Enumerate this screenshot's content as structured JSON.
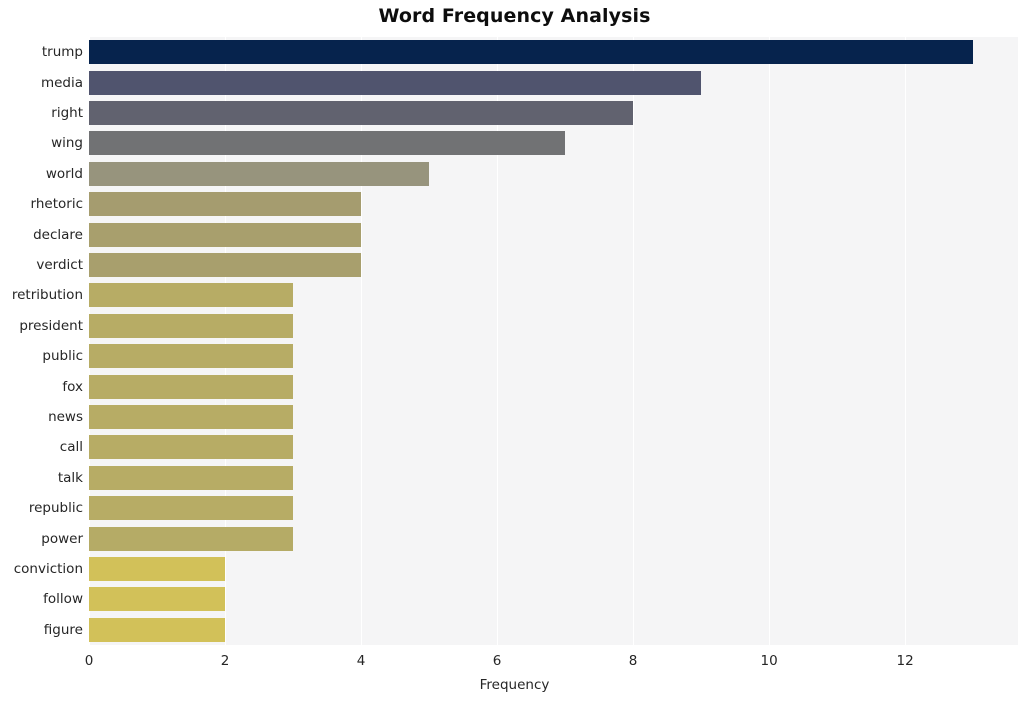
{
  "chart_data": {
    "type": "bar",
    "orientation": "horizontal",
    "title": "Word Frequency Analysis",
    "xlabel": "Frequency",
    "ylabel": "",
    "categories": [
      "trump",
      "media",
      "right",
      "wing",
      "world",
      "rhetoric",
      "declare",
      "verdict",
      "retribution",
      "president",
      "public",
      "fox",
      "news",
      "call",
      "talk",
      "republic",
      "power",
      "conviction",
      "follow",
      "figure"
    ],
    "values": [
      13,
      9,
      8,
      7,
      5,
      4,
      4,
      4,
      3,
      3,
      3,
      3,
      3,
      3,
      3,
      3,
      3,
      2,
      2,
      2
    ],
    "bar_colors": [
      "#06234d",
      "#50546e",
      "#61626f",
      "#717274",
      "#97947d",
      "#a59c6f",
      "#a89f6d",
      "#a89f6d",
      "#b7ac65",
      "#b7ac65",
      "#b7ac65",
      "#b7ac65",
      "#b7ac65",
      "#b7ac65",
      "#b7ac65",
      "#b7ac65",
      "#b5ab66",
      "#d2c159",
      "#d2c159",
      "#d2c159"
    ],
    "xlim": [
      0,
      13.66
    ],
    "ylim": [
      0,
      20
    ],
    "xticks": [
      0,
      2,
      4,
      6,
      8,
      10,
      12
    ],
    "xtick_labels": [
      "0",
      "2",
      "4",
      "6",
      "8",
      "10",
      "12"
    ],
    "grid": true,
    "grid_axis": "x",
    "grid_color": "#ffffff",
    "plot_background": "#f5f5f6",
    "figure_background": "#ffffff",
    "legend": null,
    "tick_label_color": "#262626",
    "title_color": "#0d0d0d"
  }
}
